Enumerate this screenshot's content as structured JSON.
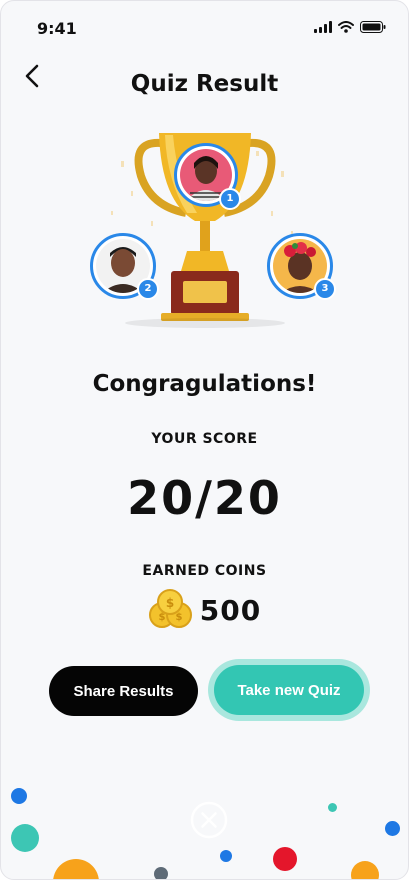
{
  "status_bar": {
    "time": "9:41"
  },
  "header": {
    "title": "Quiz Result"
  },
  "podium": [
    {
      "rank": "1",
      "name": "winner-avatar"
    },
    {
      "rank": "2",
      "name": "second-place-avatar"
    },
    {
      "rank": "3",
      "name": "third-place-avatar"
    }
  ],
  "result": {
    "congrats": "Congragulations!",
    "score_label": "YOUR SCORE",
    "score_value": "20/20",
    "coins_label": "EARNED COINS",
    "coins_value": "500"
  },
  "actions": {
    "share_label": "Share Results",
    "new_quiz_label": "Take new Quiz"
  },
  "colors": {
    "accent_blue": "#2a88e8",
    "teal": "#33c6b3",
    "teal_glow": "#a9e7de",
    "black_button": "#050505",
    "confetti_orange": "#f7a21b",
    "confetti_red": "#e4162b"
  },
  "icons": [
    "back-arrow-icon",
    "signal-icon",
    "wifi-icon",
    "battery-icon",
    "trophy-icon",
    "coins-icon",
    "close-icon"
  ]
}
